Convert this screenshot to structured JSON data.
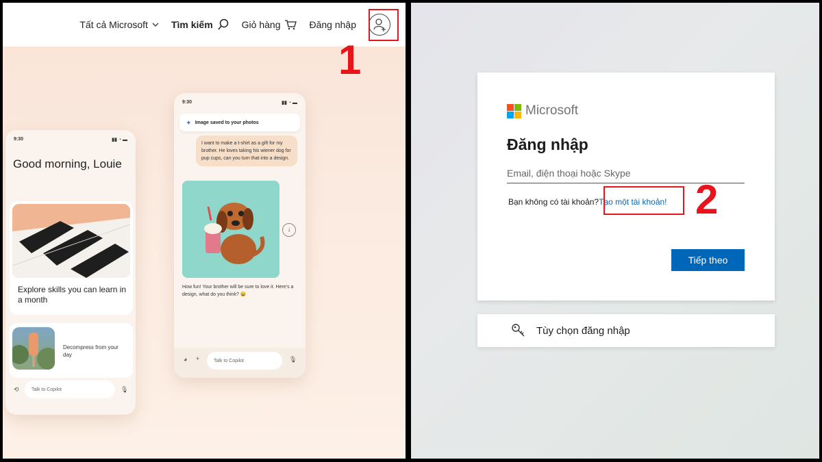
{
  "left_panel": {
    "nav": {
      "all_microsoft": "Tất cả Microsoft",
      "search": "Tìm kiếm",
      "cart": "Giỏ hàng",
      "sign_in": "Đăng nhập",
      "avatar_icon": "user-add-icon"
    },
    "step_marker": "1",
    "phone_a": {
      "time": "9:30",
      "greeting": "Good morning, Louie",
      "card1_caption": "Explore skills you can learn in a month",
      "card2_caption": "Decompress from your day",
      "talk_placeholder": "Talk to Copilot"
    },
    "phone_b": {
      "time": "9:30",
      "toast": "Image saved to your photos",
      "user_message": "I want to make a t-shirt as a gift for my brother. He loves taking his wiener dog for pup cups, can you turn that into a design.",
      "reply": "How fun! Your brother will be sure to love it. Here's a design, what do you think? 😄",
      "talk_placeholder": "Talk to Copilot"
    }
  },
  "right_panel": {
    "brand": "Microsoft",
    "title": "Đăng nhập",
    "email_placeholder": "Email, điện thoại hoặc Skype",
    "no_account_text": "Bạn không có tài khoản?",
    "create_account_link": "Tạo một tài khoản!",
    "step_marker": "2",
    "next_button": "Tiếp theo",
    "signin_options": "Tùy chọn đăng nhập",
    "logo_colors": [
      "#f25022",
      "#7fba00",
      "#00a4ef",
      "#ffb900"
    ],
    "accent_color": "#0067b8",
    "highlight_color": "#e8141b"
  }
}
